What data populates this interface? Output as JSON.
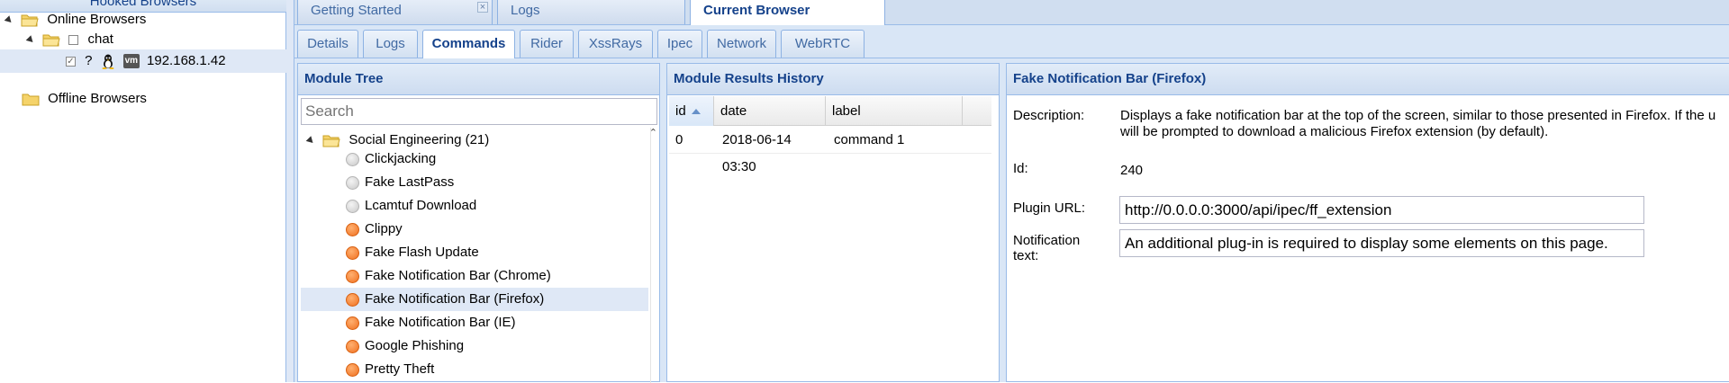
{
  "left_panel": {
    "title": "Hooked Browsers",
    "online_label": "Online Browsers",
    "group_label": "chat",
    "ip_label": "192.168.1.42",
    "unknown_glyph": "?",
    "vm_badge": "vm",
    "offline_label": "Offline Browsers"
  },
  "top_tabs": [
    {
      "label": "Getting Started",
      "close": "×"
    },
    {
      "label": "Logs"
    },
    {
      "label": "Current Browser",
      "active": true
    }
  ],
  "sub_tabs": [
    {
      "label": "Details"
    },
    {
      "label": "Logs"
    },
    {
      "label": "Commands",
      "active": true
    },
    {
      "label": "Rider"
    },
    {
      "label": "XssRays"
    },
    {
      "label": "Ipec"
    },
    {
      "label": "Network"
    },
    {
      "label": "WebRTC"
    }
  ],
  "module_tree": {
    "title": "Module Tree",
    "search_placeholder": "Search",
    "scroll_glyph": "⌃",
    "category": "Social Engineering (21)",
    "modules": [
      {
        "label": "Clickjacking",
        "status": "gray"
      },
      {
        "label": "Fake LastPass",
        "status": "gray"
      },
      {
        "label": "Lcamtuf Download",
        "status": "gray"
      },
      {
        "label": "Clippy",
        "status": "orange"
      },
      {
        "label": "Fake Flash Update",
        "status": "orange"
      },
      {
        "label": "Fake Notification Bar (Chrome)",
        "status": "orange"
      },
      {
        "label": "Fake Notification Bar (Firefox)",
        "status": "orange",
        "selected": true
      },
      {
        "label": "Fake Notification Bar (IE)",
        "status": "orange"
      },
      {
        "label": "Google Phishing",
        "status": "orange"
      },
      {
        "label": "Pretty Theft",
        "status": "orange"
      }
    ]
  },
  "results": {
    "title": "Module Results History",
    "columns": [
      "id",
      "date",
      "label"
    ],
    "rows": [
      {
        "id": "0",
        "date": "2018-06-14 03:30",
        "label": "command 1"
      }
    ]
  },
  "details": {
    "title": "Fake Notification Bar (Firefox)",
    "description_label": "Description:",
    "description_line1": "Displays a fake notification bar at the top of the screen, similar to those presented in Firefox. If the u",
    "description_line2": "will be prompted to download a malicious Firefox extension (by default).",
    "id_label": "Id:",
    "id_value": "240",
    "plugin_url_label": "Plugin URL:",
    "plugin_url_value": "http://0.0.0.0:3000/api/ipec/ff_extension",
    "notification_label_line1": "Notification",
    "notification_label_line2": "text:",
    "notification_value": "An additional plug-in is required to display some elements on this page."
  },
  "colors": {
    "header_text": "#15428b",
    "border": "#99bbe8",
    "selected_row": "#dfe8f6",
    "status_orange": "#f07020",
    "status_gray": "#c8c8c8"
  }
}
